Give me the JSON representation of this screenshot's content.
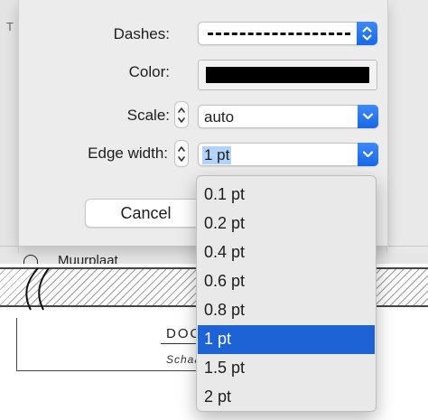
{
  "background": {
    "left_letter": "T",
    "list_item_label": "Muurplaat",
    "drawing_title": "DOO",
    "drawing_subtitle": "Schaa"
  },
  "dialog": {
    "dashes_label": "Dashes:",
    "color_label": "Color:",
    "scale_label": "Scale:",
    "scale_value": "auto",
    "edge_width_label": "Edge width:",
    "edge_width_value": "1 pt",
    "cancel_label": "Cancel",
    "line_color": "#000000",
    "accent_color": "#1e63d6",
    "icons": [
      "chevron-updown-icon",
      "chevron-down-icon",
      "stepper-up-icon",
      "stepper-down-icon"
    ]
  },
  "edge_width_menu": {
    "options": [
      "0.1 pt",
      "0.2 pt",
      "0.4 pt",
      "0.6 pt",
      "0.8 pt",
      "1 pt",
      "1.5 pt",
      "2 pt"
    ],
    "selected": "1 pt"
  }
}
